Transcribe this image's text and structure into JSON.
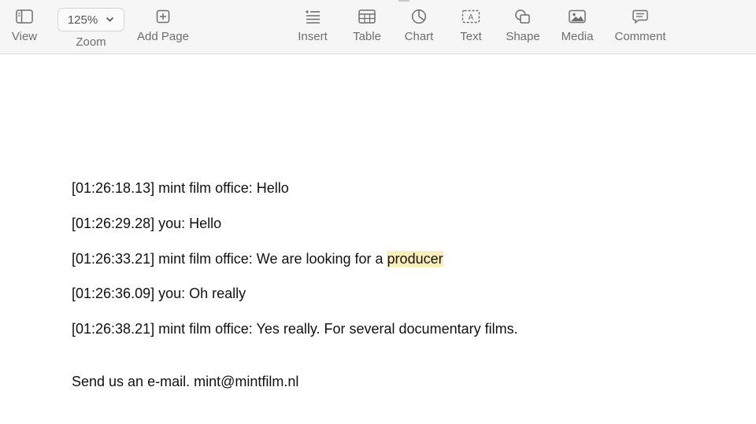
{
  "toolbar": {
    "view_label": "View",
    "zoom_value": "125%",
    "zoom_label": "Zoom",
    "add_page_label": "Add Page",
    "insert_label": "Insert",
    "table_label": "Table",
    "chart_label": "Chart",
    "text_label": "Text",
    "shape_label": "Shape",
    "media_label": "Media",
    "comment_label": "Comment",
    "text_icon_glyph": "A"
  },
  "document": {
    "lines": [
      "[01:26:18.13] mint film office: Hello",
      "[01:26:29.28] you: Hello",
      "[01:26:36.09] you: Oh really",
      "[01:26:38.21] mint film office: Yes really. For several documentary films.",
      "Send us an e-mail. mint@mintfilm.nl"
    ],
    "highlight_line": {
      "prefix": "[01:26:33.21] mint film office: We are looking for a ",
      "highlighted": "producer"
    },
    "highlight_color": "#fbefb8"
  }
}
